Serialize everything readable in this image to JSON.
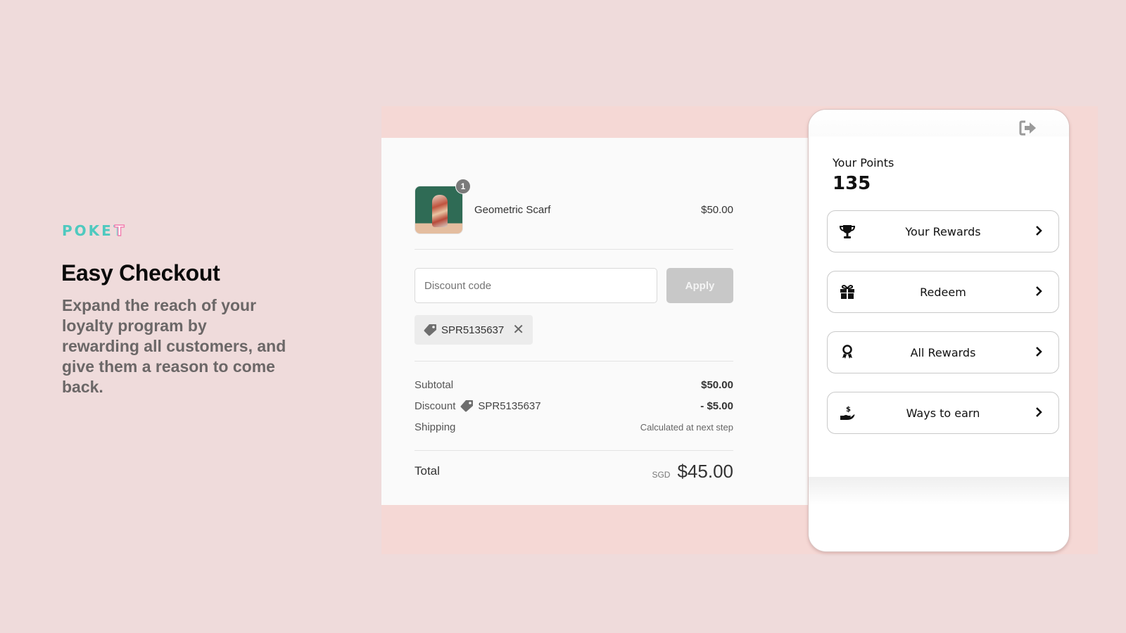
{
  "marketing": {
    "brand": "POKE",
    "brand_last_letter": "T",
    "headline": "Easy Checkout",
    "subcopy": "Expand the reach of your loyalty program by rewarding all customers, and give them a reason to come back.",
    "colors": {
      "brand_teal": "#4fc9bf",
      "brand_pink": "#f27cae",
      "page_bg": "#efdbdb",
      "backdrop_pink": "#f5d8d5"
    }
  },
  "checkout": {
    "product": {
      "name": "Geometric Scarf",
      "price": "$50.00",
      "quantity": "1",
      "image_alt": "Geometric Scarf product photo"
    },
    "discount": {
      "placeholder": "Discount code",
      "value": "",
      "apply_label": "Apply",
      "applied_code": "SPR5135637",
      "remove_icon": "close-icon"
    },
    "summary": {
      "subtotal_label": "Subtotal",
      "subtotal_value": "$50.00",
      "discount_label": "Discount",
      "discount_code": "SPR5135637",
      "discount_value": "- $5.00",
      "shipping_label": "Shipping",
      "shipping_value": "Calculated at next step"
    },
    "total": {
      "label": "Total",
      "currency": "SGD",
      "amount": "$45.00"
    }
  },
  "loyalty_widget": {
    "logout_icon": "sign-out-icon",
    "points_label": "Your Points",
    "points_value": "135",
    "menu": [
      {
        "label": "Your Rewards",
        "icon": "trophy-icon"
      },
      {
        "label": "Redeem",
        "icon": "gift-icon"
      },
      {
        "label": "All Rewards",
        "icon": "award-ribbon-icon"
      },
      {
        "label": "Ways to earn",
        "icon": "hand-dollar-icon"
      }
    ]
  }
}
